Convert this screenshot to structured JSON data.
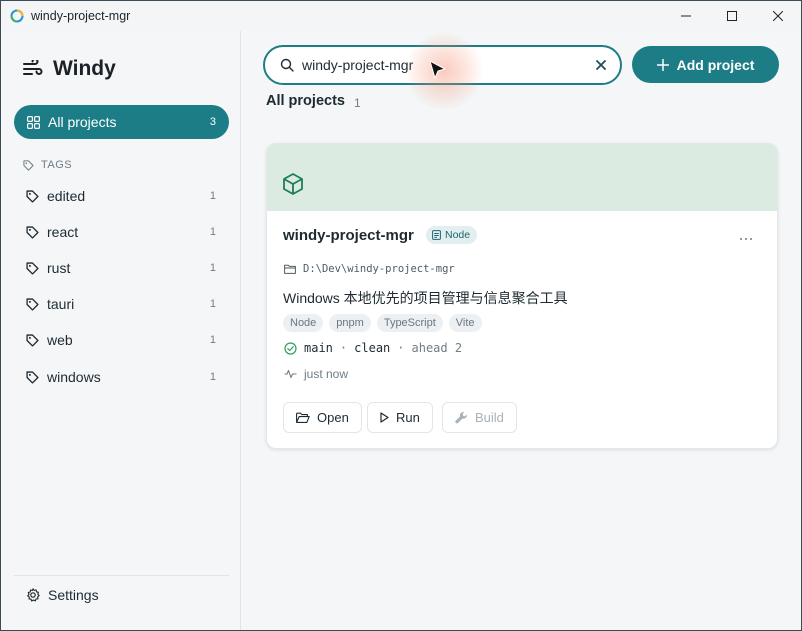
{
  "window": {
    "title": "windy-project-mgr"
  },
  "sidebar": {
    "brand": "Windy",
    "all_projects": {
      "label": "All projects",
      "count": "3"
    },
    "tags_heading": "TAGS",
    "tags": [
      {
        "label": "edited",
        "count": "1"
      },
      {
        "label": "react",
        "count": "1"
      },
      {
        "label": "rust",
        "count": "1"
      },
      {
        "label": "tauri",
        "count": "1"
      },
      {
        "label": "web",
        "count": "1"
      },
      {
        "label": "windows",
        "count": "1"
      }
    ],
    "settings_label": "Settings"
  },
  "search": {
    "value": "windy-project-mgr"
  },
  "add_button": {
    "label": "Add project"
  },
  "section": {
    "title": "All projects",
    "count": "1"
  },
  "project": {
    "name": "windy-project-mgr",
    "badge": "Node",
    "path": "D:\\Dev\\windy-project-mgr",
    "description": "Windows 本地优先的项目管理与信息聚合工具",
    "chips": [
      "Node",
      "pnpm",
      "TypeScript",
      "Vite"
    ],
    "git": {
      "branch": "main",
      "state": "clean",
      "ahead": "ahead 2"
    },
    "activity": "just now",
    "actions": {
      "open": "Open",
      "run": "Run",
      "build": "Build"
    }
  },
  "colors": {
    "accent": "#1d7d86",
    "banner": "#dcebe2"
  }
}
